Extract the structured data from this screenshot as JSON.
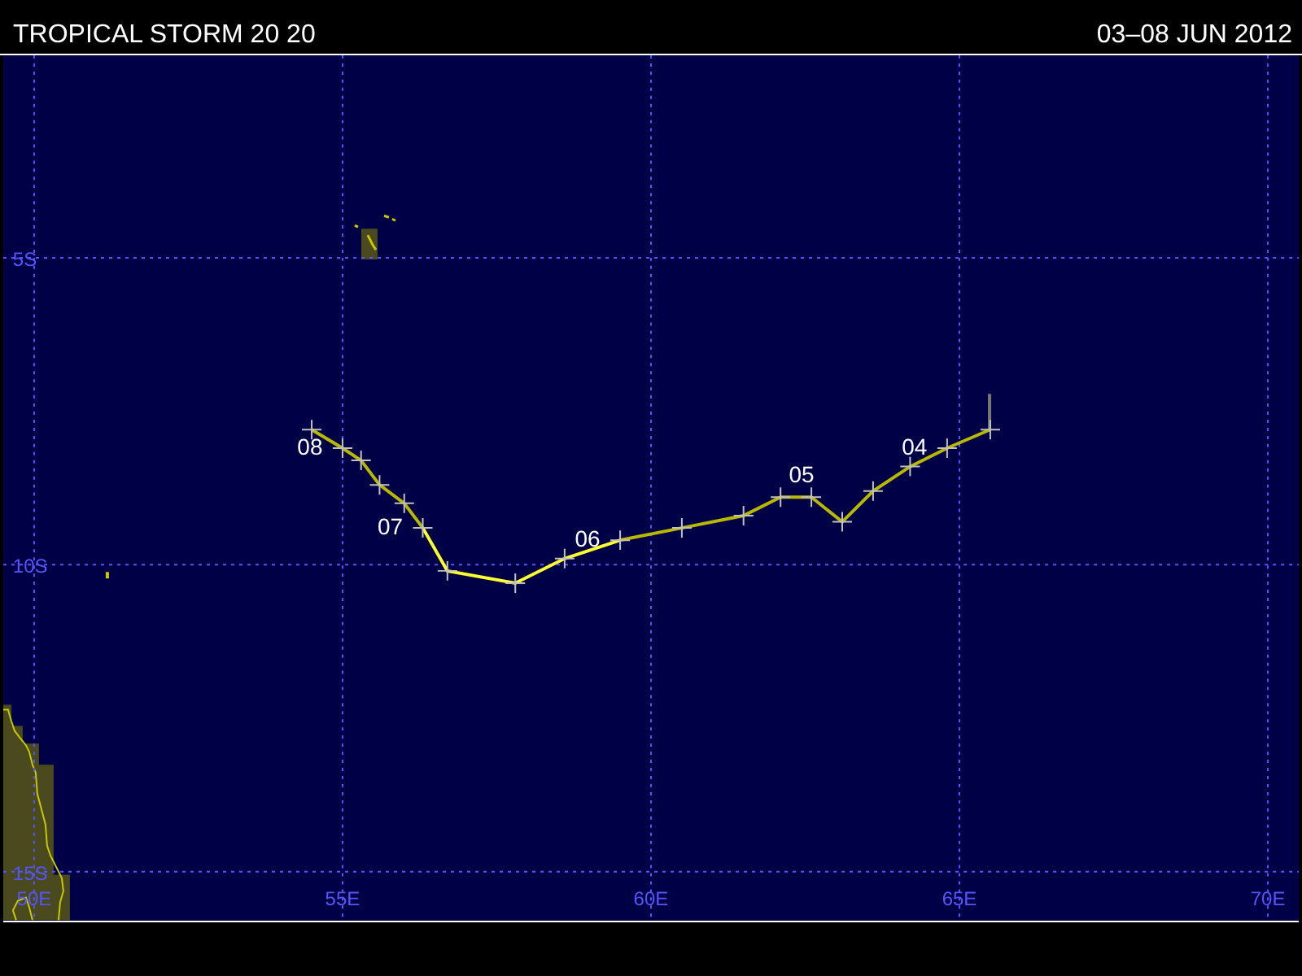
{
  "header": {
    "title": "TROPICAL STORM 20 20",
    "dates": "03–08 JUN 2012"
  },
  "map": {
    "chart_data": {
      "type": "line",
      "x": [
        54.5,
        55.0,
        55.3,
        55.6,
        56.0,
        56.3,
        56.7,
        57.8,
        58.6,
        59.5,
        60.5,
        61.5,
        62.1,
        62.6,
        63.1,
        63.6,
        64.2,
        64.8,
        65.5
      ],
      "grid": true,
      "series": [
        {
          "color": "#b8b800",
          "marker": "+",
          "values": [
            -7.8,
            -8.1,
            -8.3,
            -8.7,
            -9.0,
            -9.4,
            null,
            null,
            null,
            -9.6,
            -9.4,
            -9.2,
            -8.9,
            -8.9,
            -9.3,
            -8.8,
            -8.4,
            -8.1,
            -7.8
          ]
        },
        {
          "color": "#ffff33",
          "marker": "+",
          "values": [
            null,
            null,
            null,
            null,
            null,
            -9.4,
            -10.1,
            -10.3,
            -9.9,
            -9.6,
            null,
            null,
            null,
            null,
            null,
            null,
            null,
            null,
            null
          ]
        }
      ],
      "xlim": [
        49.5,
        70.5
      ],
      "ylim": [
        -15.8,
        -1.7
      ],
      "xticks": [
        {
          "value": 50,
          "label": "50E"
        },
        {
          "value": 55,
          "label": "55E"
        },
        {
          "value": 60,
          "label": "60E"
        },
        {
          "value": 65,
          "label": "65E"
        },
        {
          "value": 70,
          "label": "70E"
        }
      ],
      "yticks": [
        {
          "value": -5,
          "label": "5S"
        },
        {
          "value": -10,
          "label": "10S"
        },
        {
          "value": -15,
          "label": "15S"
        }
      ],
      "annotations": [
        {
          "x": 55.0,
          "y": -8.1,
          "text": "08"
        },
        {
          "x": 56.3,
          "y": -9.4,
          "text": "07"
        },
        {
          "x": 59.5,
          "y": -9.6,
          "text": "06"
        },
        {
          "x": 62.6,
          "y": -8.9,
          "text": "05"
        },
        {
          "x": 64.8,
          "y": -8.1,
          "text": "04"
        }
      ]
    }
  }
}
